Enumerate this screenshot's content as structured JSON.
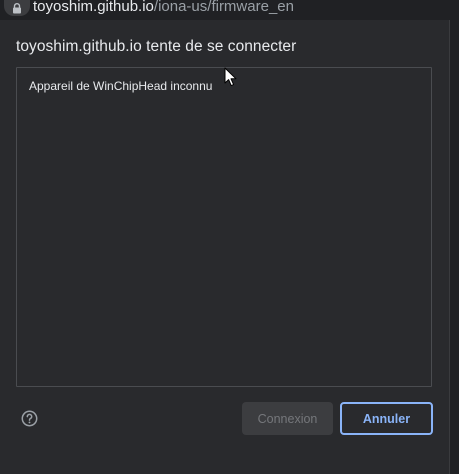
{
  "address_bar": {
    "host": "toyoshim.github.io",
    "path": "/iona-us/firmware_en"
  },
  "dialog": {
    "title": "toyoshim.github.io tente de se connecter",
    "devices": [
      {
        "label": "Appareil de WinChipHead inconnu"
      }
    ],
    "connect_label": "Connexion",
    "cancel_label": "Annuler"
  },
  "colors": {
    "dialog_background": "#292a2d",
    "accent": "#8ab4f8",
    "disabled_button": "#3c3d40",
    "disabled_text": "#75777b",
    "text": "#e8eaed",
    "url_path_text": "#9aa0a6"
  },
  "icons": {
    "lock": "lock-icon",
    "help": "help-circle-icon",
    "cursor": "mouse-pointer-icon"
  }
}
